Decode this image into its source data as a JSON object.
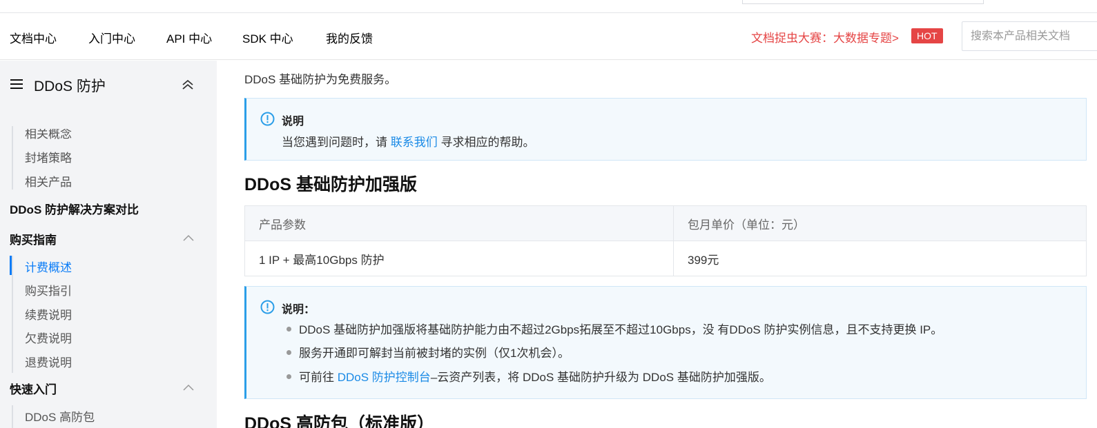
{
  "nav": {
    "items": [
      "文档中心",
      "入门中心",
      "API 中心",
      "SDK 中心",
      "我的反馈"
    ],
    "promo": "文档捉虫大赛：大数据专题>",
    "hot_badge": "HOT",
    "search_placeholder": "搜索本产品相关文档"
  },
  "sidebar": {
    "title": "DDoS 防护",
    "partial_item": "相关概念",
    "items_group1": [
      "封堵策略",
      "相关产品"
    ],
    "cat_compare": "DDoS 防护解决方案对比",
    "cat_buy": "购买指南",
    "buy_items": [
      "计费概述",
      "购买指引",
      "续费说明",
      "欠费说明",
      "退费说明"
    ],
    "active_item": "计费概述",
    "cat_quickstart": "快速入门",
    "quick_items": [
      "DDoS 高防包"
    ]
  },
  "main": {
    "intro": "DDoS 基础防护为免费服务。",
    "note1": {
      "title": "说明",
      "text_before": "当您遇到问题时，请 ",
      "link": "联系我们",
      "text_after": " 寻求相应的帮助。"
    },
    "section1_title": "DDoS 基础防护加强版",
    "table": {
      "headers": [
        "产品参数",
        "包月单价（单位：元）"
      ],
      "rows": [
        [
          "1 IP + 最高10Gbps 防护",
          "399元"
        ]
      ]
    },
    "note2": {
      "title": "说明：",
      "items": [
        "DDoS 基础防护加强版将基础防护能力由不超过2Gbps拓展至不超过10Gbps，没 有DDoS 防护实例信息，且不支持更换 IP。",
        "服务开通即可解封当前被封堵的实例（仅1次机会）。"
      ],
      "item3_before": "可前往 ",
      "item3_link": "DDoS 防护控制台",
      "item3_after": "–云资产列表，将 DDoS 基础防护升级为 DDoS 基础防护加强版。"
    },
    "section2_title": "DDoS 高防包（标准版）"
  },
  "colors": {
    "accent": "#0a7cf7",
    "link": "#1a8ae6",
    "promo_red": "#e54545",
    "note_border": "#2b9ee8"
  }
}
